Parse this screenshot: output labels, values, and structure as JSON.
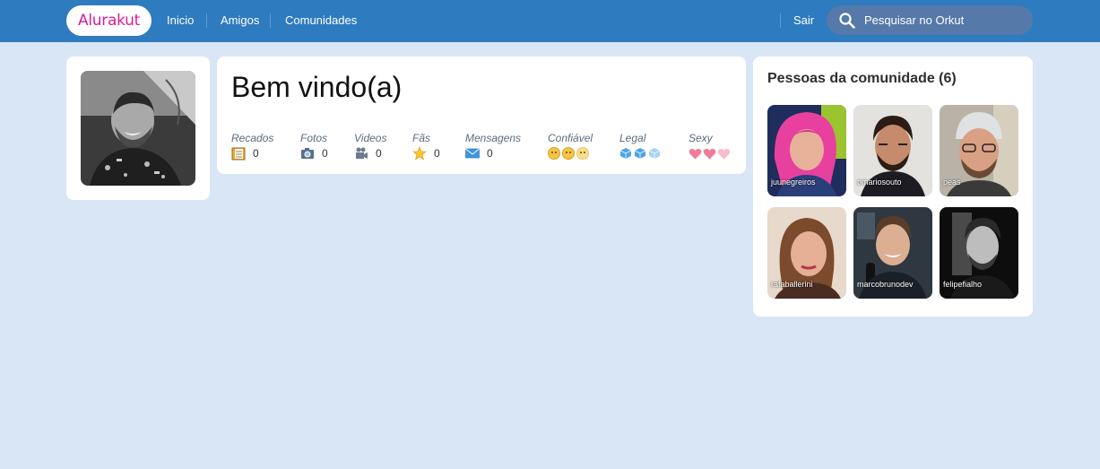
{
  "nav": {
    "logo": "Alurakut",
    "links": [
      "Inicio",
      "Amigos",
      "Comunidades"
    ],
    "logout": "Sair",
    "search_placeholder": "Pesquisar no Orkut"
  },
  "welcome": {
    "title": "Bem vindo(a)",
    "stats": [
      {
        "label": "Recados",
        "value": "0",
        "icon": "notebook-icon"
      },
      {
        "label": "Fotos",
        "value": "0",
        "icon": "camera-icon"
      },
      {
        "label": "Videos",
        "value": "0",
        "icon": "video-camera-icon"
      },
      {
        "label": "Fãs",
        "value": "0",
        "icon": "star-icon"
      },
      {
        "label": "Mensagens",
        "value": "0",
        "icon": "envelope-icon"
      },
      {
        "label": "Confiável",
        "icon": "smiley-icon"
      },
      {
        "label": "Legal",
        "icon": "ice-cube-icon"
      },
      {
        "label": "Sexy",
        "icon": "heart-icon"
      }
    ]
  },
  "community": {
    "title": "Pessoas da comunidade (6)",
    "people": [
      {
        "name": "juunegreiros"
      },
      {
        "name": "omariosouto"
      },
      {
        "name": "peas"
      },
      {
        "name": "rafaballerini"
      },
      {
        "name": "marcobrunodev"
      },
      {
        "name": "felipefialho"
      }
    ]
  },
  "colors": {
    "header": "#2e7bbf",
    "background": "#d9e6f6",
    "logo_text": "#d81d99",
    "search_bg": "#5579a8"
  }
}
